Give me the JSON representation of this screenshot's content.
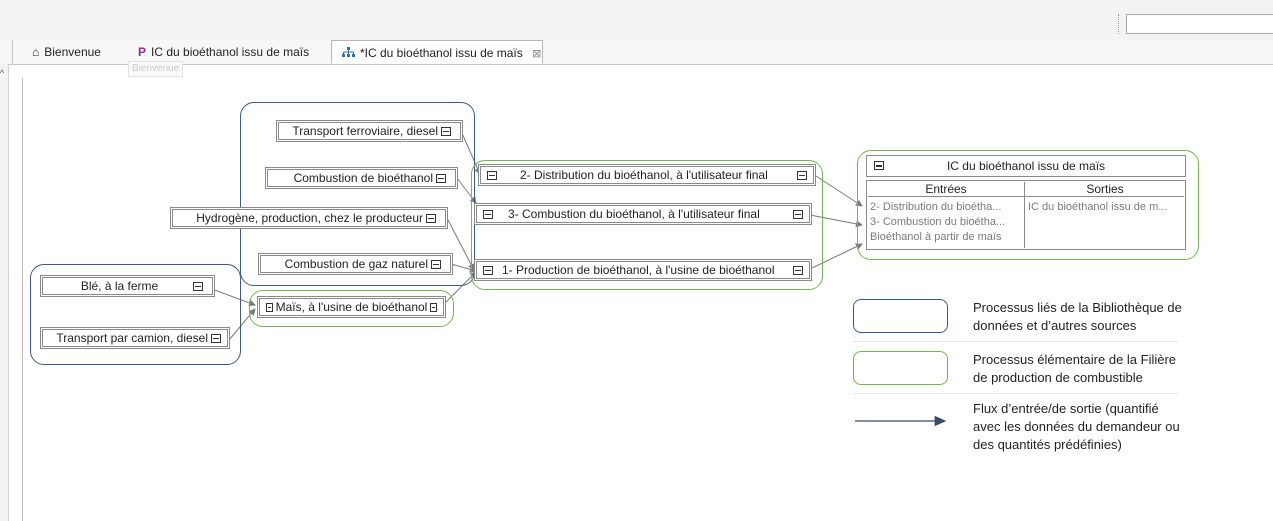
{
  "tabs": [
    {
      "label": "Bienvenue",
      "icon": "home-icon",
      "active": false
    },
    {
      "label": "IC du bioéthanol issu de maïs",
      "icon": "p-icon",
      "active": false
    },
    {
      "label": "*IC du bioéthanol issu de maïs",
      "icon": "hierarchy-icon",
      "active": true,
      "close": "⊠"
    }
  ],
  "tooltip": "Bienvenue",
  "nodes": {
    "transport_ferroviaire": "Transport ferroviaire, diesel",
    "combustion_bioethanol": "Combustion de bioéthanol",
    "hydrogene": "Hydrogène, production, chez le producteur",
    "combustion_gaz": "Combustion de gaz naturel",
    "ble": "Blé, à la ferme",
    "transport_camion": "Transport par camion, diesel",
    "mais": "Maïs, à l'usine de bioéthanol",
    "distribution": "2- Distribution du bioéthanol, à l'utilisateur final",
    "combustion_final": "3- Combustion du bioéthanol, à l'utilisateur final",
    "production": "1- Production de bioéthanol, à l'usine de bioéthanol"
  },
  "result": {
    "title": "IC du bioéthanol issu de maïs",
    "inputs_header": "Entrées",
    "outputs_header": "Sorties",
    "inputs": [
      "2- Distribution du bioétha...",
      "3- Combustion du bioétha...",
      "Bioéthanol à partir de maïs"
    ],
    "outputs": [
      "IC du bioéthanol issu de m..."
    ]
  },
  "legend": {
    "blue_text": "Processus liés de la Bibliothèque de données et d’autres sources",
    "green_text": "Processus élémentaire de la Filière de production de combustible",
    "arrow_text": "Flux d’entrée/de sortie (quantifié avec les données du demandeur ou des quantités prédéfinies)"
  },
  "colors": {
    "blue_group": "#3c5a86",
    "green_group": "#77b356",
    "edge": "#7a7a7a",
    "legend_arrow": "#3c4a66"
  }
}
